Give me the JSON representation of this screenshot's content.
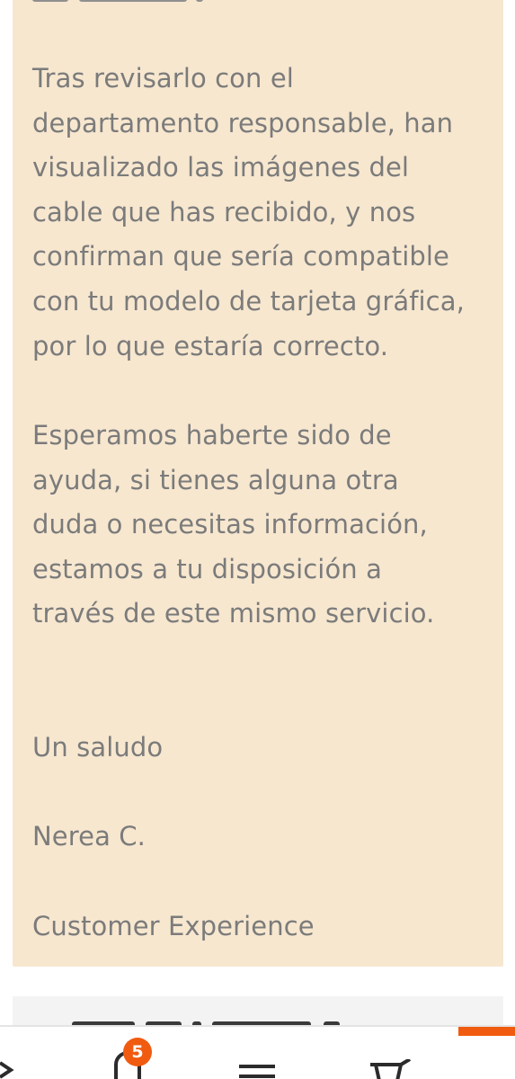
{
  "message": {
    "paragraph_1": [
      "Tras revisarlo con el",
      "departamento responsable, han",
      "visualizado las imágenes del",
      "cable que has recibido, y nos",
      "confirman que sería compatible",
      "con tu modelo de tarjeta gráfica,",
      "por lo que estaría correcto."
    ],
    "paragraph_2": [
      "Esperamos haberte sido de",
      "ayuda, si tienes alguna otra",
      "duda o necesitas información,",
      "estamos a tu disposición a",
      "través de este mismo servicio."
    ],
    "closing": "Un saludo",
    "agent_name": "Nerea C.",
    "team": "Customer Experience"
  },
  "bottom_nav": {
    "notifications_badge": "5",
    "accent_color": "#f05b0f",
    "icons": [
      "share-icon",
      "bell-icon",
      "menu-icon",
      "cart-icon"
    ]
  },
  "colors": {
    "card_background": "#f7e7cf",
    "text": "#7b7b7b",
    "accent": "#f05b0f"
  }
}
